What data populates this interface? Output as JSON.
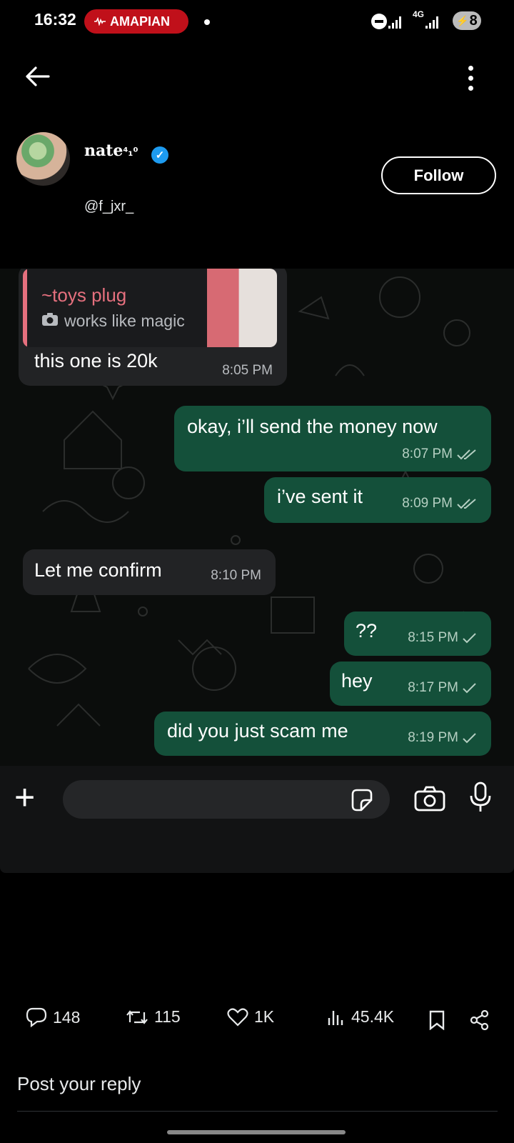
{
  "status_bar": {
    "time": "16:32",
    "music_label": "AMAPIAN",
    "network": "4G",
    "battery": "8"
  },
  "profile": {
    "name": "nate",
    "name_suffix": "⁴₁⁰",
    "handle": "@f_jxr_",
    "follow_label": "Follow"
  },
  "chat": {
    "reply_preview": {
      "title": "~toys plug",
      "subtitle": "works like magic"
    },
    "messages": [
      {
        "text": "this one is 20k",
        "time": "8:05 PM",
        "dir": "in"
      },
      {
        "text": "okay, i’ll send the money now",
        "time": "8:07 PM",
        "dir": "out",
        "status": "read"
      },
      {
        "text": "i’ve sent it",
        "time": "8:09 PM",
        "dir": "out",
        "status": "read"
      },
      {
        "text": "Let me confirm",
        "time": "8:10 PM",
        "dir": "in"
      },
      {
        "text": "??",
        "time": "8:15 PM",
        "dir": "out",
        "status": "sent"
      },
      {
        "text": "hey",
        "time": "8:17 PM",
        "dir": "out",
        "status": "sent"
      },
      {
        "text": "did you just scam me",
        "time": "8:19 PM",
        "dir": "out",
        "status": "sent"
      }
    ]
  },
  "tweet_actions": {
    "replies": "148",
    "reposts": "115",
    "likes": "1K",
    "views": "45.4K"
  },
  "reply_prompt": "Post your reply",
  "colors": {
    "outgoing_bubble": "#14503a",
    "incoming_bubble": "#222325",
    "verified_blue": "#1d9bf0",
    "reply_accent": "#e5707e"
  }
}
